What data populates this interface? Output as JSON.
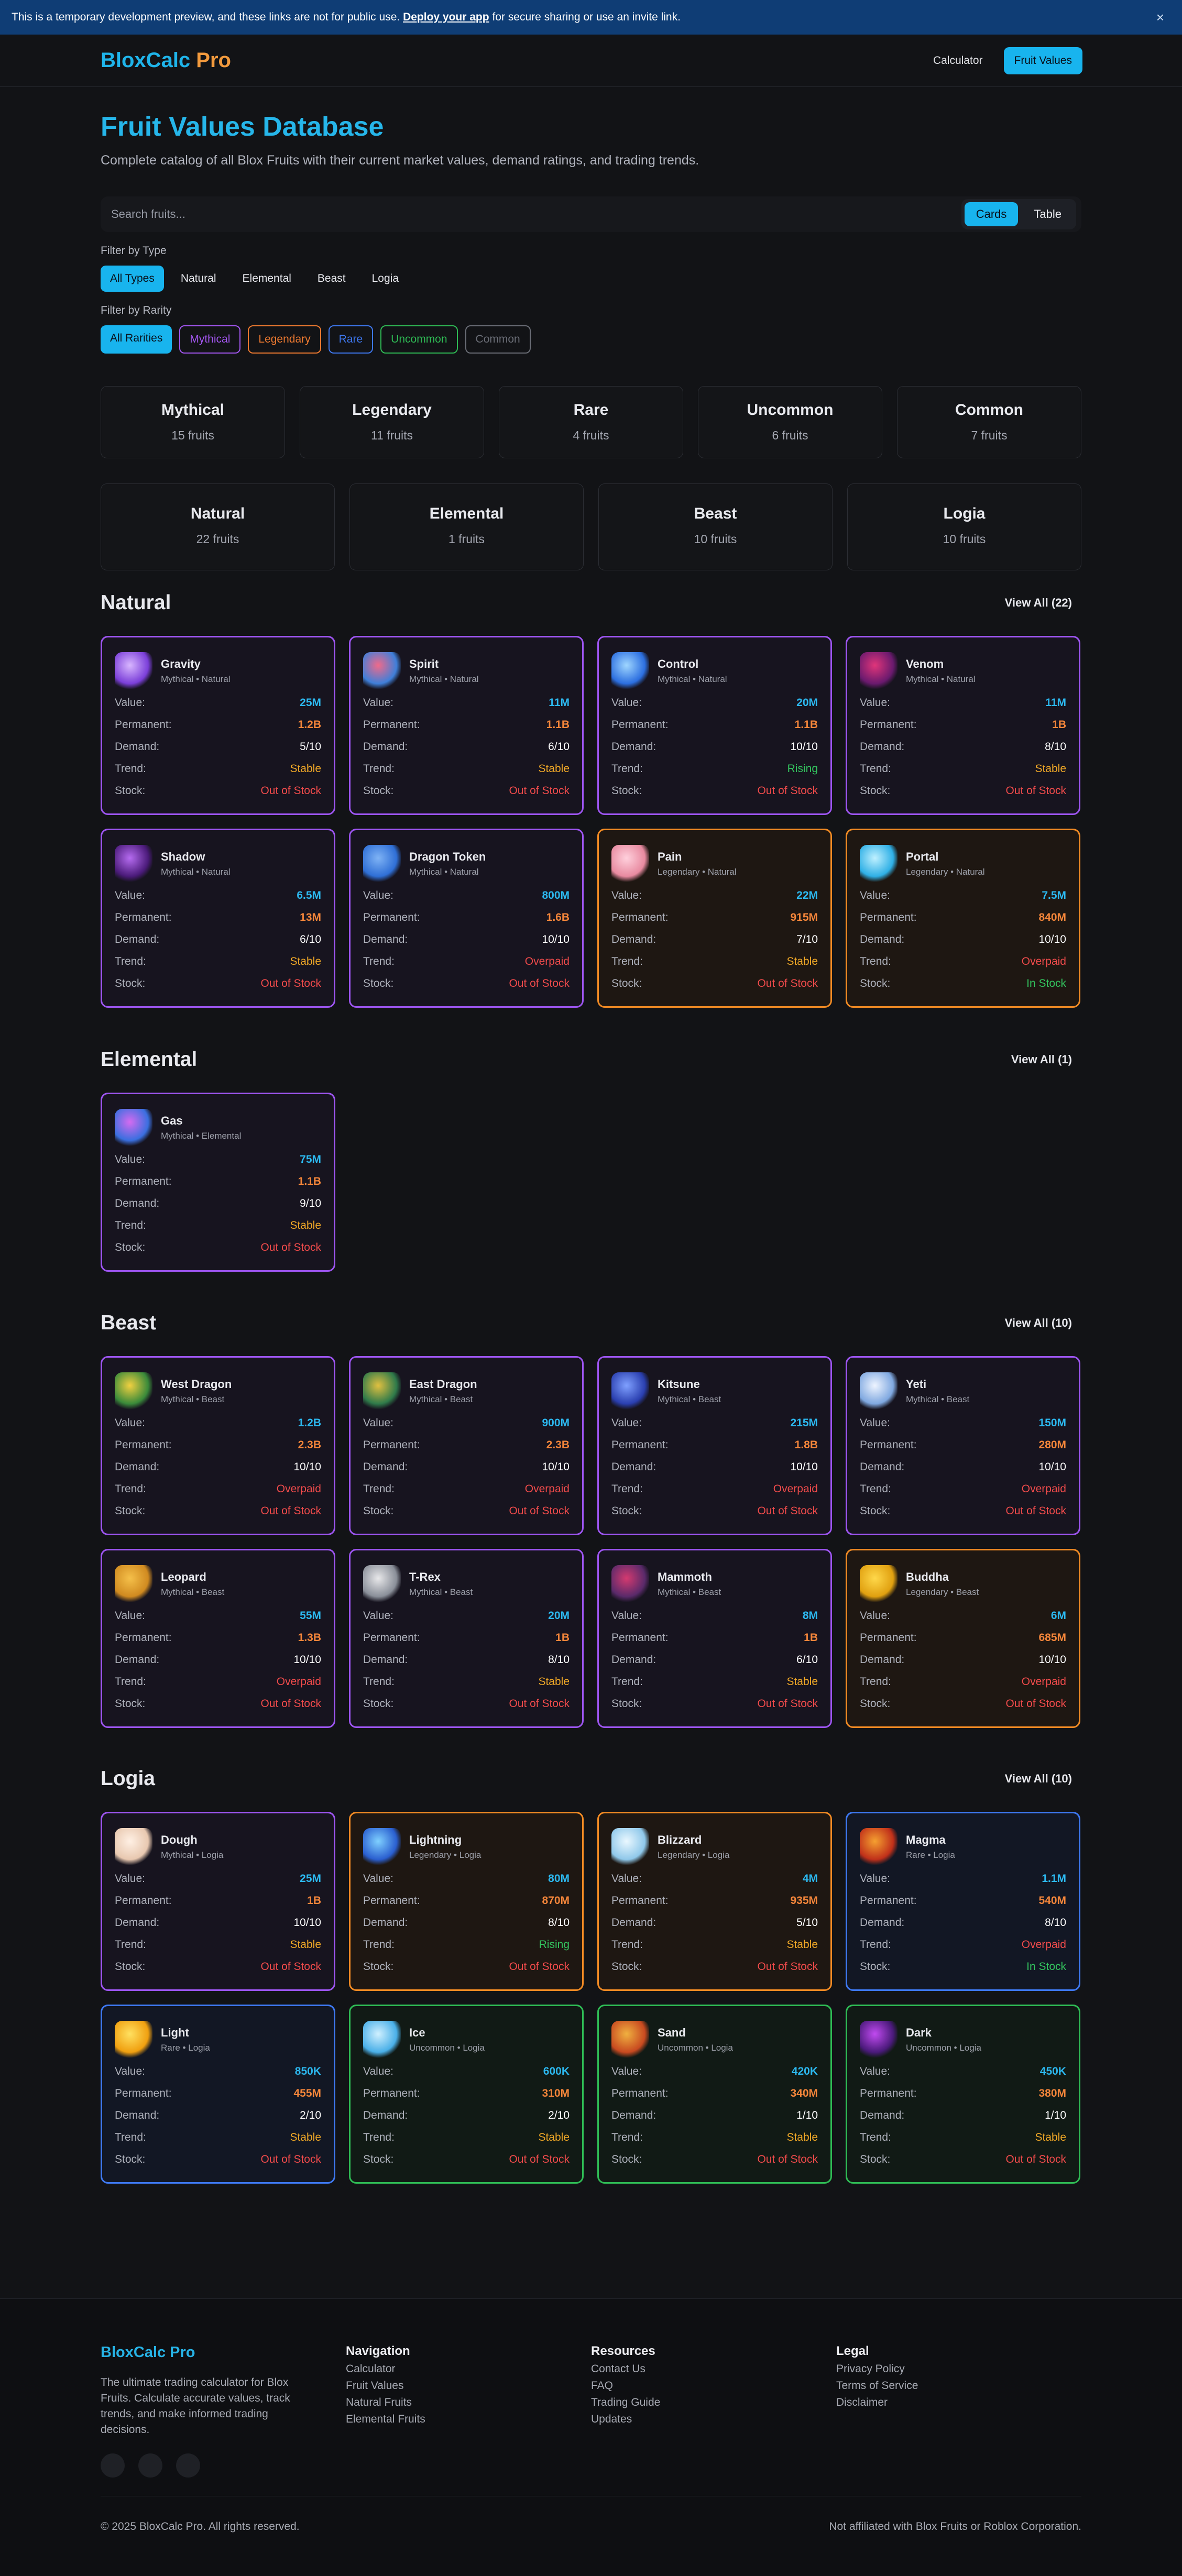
{
  "banner": {
    "pre": "This is a temporary development preview, and these links are not for public use.",
    "link": "Deploy your app",
    "post": "for secure sharing or use an invite link.",
    "close": "×"
  },
  "nav": {
    "logo_a": "BloxCalc",
    "logo_b": "Pro",
    "calculator": "Calculator",
    "fruit_values": "Fruit Values"
  },
  "page": {
    "title": "Fruit Values Database",
    "subtitle": "Complete catalog of all Blox Fruits with their current market values, demand ratings, and trading trends."
  },
  "search": {
    "placeholder": "Search fruits...",
    "cards": "Cards",
    "table": "Table"
  },
  "filters": {
    "type_label": "Filter by Type",
    "types": [
      "All Types",
      "Natural",
      "Elemental",
      "Beast",
      "Logia"
    ],
    "rarity_label": "Filter by Rarity",
    "rarities": [
      "All Rarities",
      "Mythical",
      "Legendary",
      "Rare",
      "Uncommon",
      "Common"
    ],
    "rarity_colors": [
      "",
      "#a457f2",
      "#ef7a30",
      "#3e78f0",
      "#2fbb55",
      "#6b6e77"
    ]
  },
  "rarity_stats": [
    {
      "t": "Mythical",
      "c": "15 fruits"
    },
    {
      "t": "Legendary",
      "c": "11 fruits"
    },
    {
      "t": "Rare",
      "c": "4 fruits"
    },
    {
      "t": "Uncommon",
      "c": "6 fruits"
    },
    {
      "t": "Common",
      "c": "7 fruits"
    }
  ],
  "type_stats": [
    {
      "t": "Natural",
      "c": "22 fruits"
    },
    {
      "t": "Elemental",
      "c": "1 fruits"
    },
    {
      "t": "Beast",
      "c": "10 fruits"
    },
    {
      "t": "Logia",
      "c": "10 fruits"
    }
  ],
  "labels": {
    "value": "Value:",
    "permanent": "Permanent:",
    "demand": "Demand:",
    "trend": "Trend:",
    "stock": "Stock:"
  },
  "sections": [
    {
      "title": "Natural",
      "view_all": "View All (22)",
      "fruits": [
        {
          "name": "Gravity",
          "meta": "Mythical • Natural",
          "rarity": "mythical",
          "value": "25M",
          "perm": "1.2B",
          "demand": "5/10",
          "trend": "Stable",
          "stock": "Out of Stock",
          "icon": "gravity-icon",
          "c1": "#7b3fd9",
          "c2": "#d8b6ff"
        },
        {
          "name": "Spirit",
          "meta": "Mythical • Natural",
          "rarity": "mythical",
          "value": "11M",
          "perm": "1.1B",
          "demand": "6/10",
          "trend": "Stable",
          "stock": "Out of Stock",
          "icon": "spirit-icon",
          "c1": "#3f7fd9",
          "c2": "#f06a8a"
        },
        {
          "name": "Control",
          "meta": "Mythical • Natural",
          "rarity": "mythical",
          "value": "20M",
          "perm": "1.1B",
          "demand": "10/10",
          "trend": "Rising",
          "stock": "Out of Stock",
          "icon": "control-icon",
          "c1": "#2c6fe0",
          "c2": "#9fd6ff"
        },
        {
          "name": "Venom",
          "meta": "Mythical • Natural",
          "rarity": "mythical",
          "value": "11M",
          "perm": "1B",
          "demand": "8/10",
          "trend": "Stable",
          "stock": "Out of Stock",
          "icon": "venom-icon",
          "c1": "#6a1a6e",
          "c2": "#e0357a"
        },
        {
          "name": "Shadow",
          "meta": "Mythical • Natural",
          "rarity": "mythical",
          "value": "6.5M",
          "perm": "13M",
          "demand": "6/10",
          "trend": "Stable",
          "stock": "Out of Stock",
          "icon": "shadow-icon",
          "c1": "#4b1b7a",
          "c2": "#b56bf0"
        },
        {
          "name": "Dragon Token",
          "meta": "Mythical • Natural",
          "rarity": "mythical",
          "value": "800M",
          "perm": "1.6B",
          "demand": "10/10",
          "trend": "Overpaid",
          "stock": "Out of Stock",
          "icon": "dragon-token-icon",
          "c1": "#2f6fd6",
          "c2": "#7fb3f5"
        },
        {
          "name": "Pain",
          "meta": "Legendary • Natural",
          "rarity": "legendary",
          "value": "22M",
          "perm": "915M",
          "demand": "7/10",
          "trend": "Stable",
          "stock": "Out of Stock",
          "icon": "pain-icon",
          "c1": "#e88aa0",
          "c2": "#ffd0dc"
        },
        {
          "name": "Portal",
          "meta": "Legendary • Natural",
          "rarity": "legendary",
          "value": "7.5M",
          "perm": "840M",
          "demand": "10/10",
          "trend": "Overpaid",
          "stock": "In Stock",
          "icon": "portal-icon",
          "c1": "#2fb0e6",
          "c2": "#bff0ff"
        }
      ]
    },
    {
      "title": "Elemental",
      "view_all": "View All (1)",
      "fruits": [
        {
          "name": "Gas",
          "meta": "Mythical • Elemental",
          "rarity": "mythical",
          "value": "75M",
          "perm": "1.1B",
          "demand": "9/10",
          "trend": "Stable",
          "stock": "Out of Stock",
          "icon": "gas-icon",
          "c1": "#3a6fe0",
          "c2": "#d46bf0"
        }
      ]
    },
    {
      "title": "Beast",
      "view_all": "View All (10)",
      "fruits": [
        {
          "name": "West Dragon",
          "meta": "Mythical • Beast",
          "rarity": "mythical",
          "value": "1.2B",
          "perm": "2.3B",
          "demand": "10/10",
          "trend": "Overpaid",
          "stock": "Out of Stock",
          "icon": "west-dragon-icon",
          "c1": "#3a8a3a",
          "c2": "#f0d040"
        },
        {
          "name": "East Dragon",
          "meta": "Mythical • Beast",
          "rarity": "mythical",
          "value": "900M",
          "perm": "2.3B",
          "demand": "10/10",
          "trend": "Overpaid",
          "stock": "Out of Stock",
          "icon": "east-dragon-icon",
          "c1": "#2f7a4a",
          "c2": "#e0c040"
        },
        {
          "name": "Kitsune",
          "meta": "Mythical • Beast",
          "rarity": "mythical",
          "value": "215M",
          "perm": "1.8B",
          "demand": "10/10",
          "trend": "Overpaid",
          "stock": "Out of Stock",
          "icon": "kitsune-icon",
          "c1": "#2a3fb0",
          "c2": "#7fa0ff"
        },
        {
          "name": "Yeti",
          "meta": "Mythical • Beast",
          "rarity": "mythical",
          "value": "150M",
          "perm": "280M",
          "demand": "10/10",
          "trend": "Overpaid",
          "stock": "Out of Stock",
          "icon": "yeti-icon",
          "c1": "#7fa8e0",
          "c2": "#eef4ff"
        },
        {
          "name": "Leopard",
          "meta": "Mythical • Beast",
          "rarity": "mythical",
          "value": "55M",
          "perm": "1.3B",
          "demand": "10/10",
          "trend": "Overpaid",
          "stock": "Out of Stock",
          "icon": "leopard-icon",
          "c1": "#d08a20",
          "c2": "#f5c04a"
        },
        {
          "name": "T-Rex",
          "meta": "Mythical • Beast",
          "rarity": "mythical",
          "value": "20M",
          "perm": "1B",
          "demand": "8/10",
          "trend": "Stable",
          "stock": "Out of Stock",
          "icon": "t-rex-icon",
          "c1": "#8a8f99",
          "c2": "#e8e8ea"
        },
        {
          "name": "Mammoth",
          "meta": "Mythical • Beast",
          "rarity": "mythical",
          "value": "8M",
          "perm": "1B",
          "demand": "6/10",
          "trend": "Stable",
          "stock": "Out of Stock",
          "icon": "mammoth-icon",
          "c1": "#5a2a6a",
          "c2": "#d43a70"
        },
        {
          "name": "Buddha",
          "meta": "Legendary • Beast",
          "rarity": "legendary",
          "value": "6M",
          "perm": "685M",
          "demand": "10/10",
          "trend": "Overpaid",
          "stock": "Out of Stock",
          "icon": "buddha-icon",
          "c1": "#e0a010",
          "c2": "#ffd84a"
        }
      ]
    },
    {
      "title": "Logia",
      "view_all": "View All (10)",
      "fruits": [
        {
          "name": "Dough",
          "meta": "Mythical • Logia",
          "rarity": "mythical",
          "value": "25M",
          "perm": "1B",
          "demand": "10/10",
          "trend": "Stable",
          "stock": "Out of Stock",
          "icon": "dough-icon",
          "c1": "#e8c8b0",
          "c2": "#fff0e4"
        },
        {
          "name": "Lightning",
          "meta": "Legendary • Logia",
          "rarity": "legendary",
          "value": "80M",
          "perm": "870M",
          "demand": "8/10",
          "trend": "Rising",
          "stock": "Out of Stock",
          "icon": "lightning-icon",
          "c1": "#2a5fd0",
          "c2": "#7fd0ff"
        },
        {
          "name": "Blizzard",
          "meta": "Legendary • Logia",
          "rarity": "legendary",
          "value": "4M",
          "perm": "935M",
          "demand": "5/10",
          "trend": "Stable",
          "stock": "Out of Stock",
          "icon": "blizzard-icon",
          "c1": "#8fc8ea",
          "c2": "#eaf8ff"
        },
        {
          "name": "Magma",
          "meta": "Rare • Logia",
          "rarity": "rare",
          "value": "1.1M",
          "perm": "540M",
          "demand": "8/10",
          "trend": "Overpaid",
          "stock": "In Stock",
          "icon": "magma-icon",
          "c1": "#c0301a",
          "c2": "#f5a030"
        },
        {
          "name": "Light",
          "meta": "Rare • Logia",
          "rarity": "rare",
          "value": "850K",
          "perm": "455M",
          "demand": "2/10",
          "trend": "Stable",
          "stock": "Out of Stock",
          "icon": "light-icon",
          "c1": "#f0a010",
          "c2": "#ffe060"
        },
        {
          "name": "Ice",
          "meta": "Uncommon • Logia",
          "rarity": "uncommon",
          "value": "600K",
          "perm": "310M",
          "demand": "2/10",
          "trend": "Stable",
          "stock": "Out of Stock",
          "icon": "ice-icon",
          "c1": "#4ab0e8",
          "c2": "#d0f0ff"
        },
        {
          "name": "Sand",
          "meta": "Uncommon • Logia",
          "rarity": "uncommon",
          "value": "420K",
          "perm": "340M",
          "demand": "1/10",
          "trend": "Stable",
          "stock": "Out of Stock",
          "icon": "sand-icon",
          "c1": "#c84a20",
          "c2": "#f0b040"
        },
        {
          "name": "Dark",
          "meta": "Uncommon • Logia",
          "rarity": "uncommon",
          "value": "450K",
          "perm": "380M",
          "demand": "1/10",
          "trend": "Stable",
          "stock": "Out of Stock",
          "icon": "dark-icon",
          "c1": "#4a1a7a",
          "c2": "#c04af0"
        }
      ]
    }
  ],
  "footer": {
    "brand": "BloxCalc Pro",
    "desc": "The ultimate trading calculator for Blox Fruits. Calculate accurate values, track trends, and make informed trading decisions.",
    "nav_title": "Navigation",
    "nav": [
      "Calculator",
      "Fruit Values",
      "Natural Fruits",
      "Elemental Fruits"
    ],
    "res_title": "Resources",
    "res": [
      "Contact Us",
      "FAQ",
      "Trading Guide",
      "Updates"
    ],
    "legal_title": "Legal",
    "legal": [
      "Privacy Policy",
      "Terms of Service",
      "Disclaimer"
    ],
    "copyright": "© 2025 BloxCalc Pro. All rights reserved.",
    "disclaimer": "Not affiliated with Blox Fruits or Roblox Corporation."
  }
}
